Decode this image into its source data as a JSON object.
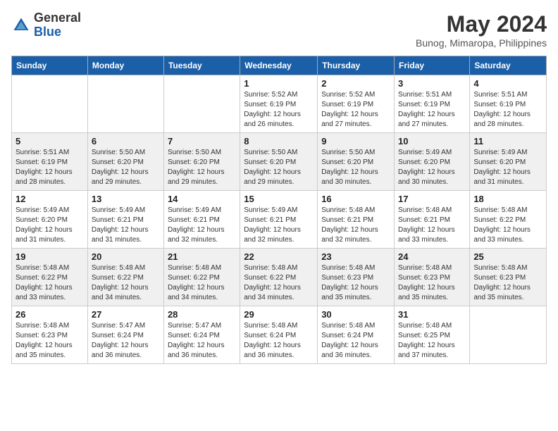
{
  "header": {
    "logo_line1": "General",
    "logo_line2": "Blue",
    "month_title": "May 2024",
    "location": "Bunog, Mimaropa, Philippines"
  },
  "days_of_week": [
    "Sunday",
    "Monday",
    "Tuesday",
    "Wednesday",
    "Thursday",
    "Friday",
    "Saturday"
  ],
  "weeks": [
    [
      {
        "day": "",
        "info": ""
      },
      {
        "day": "",
        "info": ""
      },
      {
        "day": "",
        "info": ""
      },
      {
        "day": "1",
        "info": "Sunrise: 5:52 AM\nSunset: 6:19 PM\nDaylight: 12 hours and 26 minutes."
      },
      {
        "day": "2",
        "info": "Sunrise: 5:52 AM\nSunset: 6:19 PM\nDaylight: 12 hours and 27 minutes."
      },
      {
        "day": "3",
        "info": "Sunrise: 5:51 AM\nSunset: 6:19 PM\nDaylight: 12 hours and 27 minutes."
      },
      {
        "day": "4",
        "info": "Sunrise: 5:51 AM\nSunset: 6:19 PM\nDaylight: 12 hours and 28 minutes."
      }
    ],
    [
      {
        "day": "5",
        "info": "Sunrise: 5:51 AM\nSunset: 6:19 PM\nDaylight: 12 hours and 28 minutes."
      },
      {
        "day": "6",
        "info": "Sunrise: 5:50 AM\nSunset: 6:20 PM\nDaylight: 12 hours and 29 minutes."
      },
      {
        "day": "7",
        "info": "Sunrise: 5:50 AM\nSunset: 6:20 PM\nDaylight: 12 hours and 29 minutes."
      },
      {
        "day": "8",
        "info": "Sunrise: 5:50 AM\nSunset: 6:20 PM\nDaylight: 12 hours and 29 minutes."
      },
      {
        "day": "9",
        "info": "Sunrise: 5:50 AM\nSunset: 6:20 PM\nDaylight: 12 hours and 30 minutes."
      },
      {
        "day": "10",
        "info": "Sunrise: 5:49 AM\nSunset: 6:20 PM\nDaylight: 12 hours and 30 minutes."
      },
      {
        "day": "11",
        "info": "Sunrise: 5:49 AM\nSunset: 6:20 PM\nDaylight: 12 hours and 31 minutes."
      }
    ],
    [
      {
        "day": "12",
        "info": "Sunrise: 5:49 AM\nSunset: 6:20 PM\nDaylight: 12 hours and 31 minutes."
      },
      {
        "day": "13",
        "info": "Sunrise: 5:49 AM\nSunset: 6:21 PM\nDaylight: 12 hours and 31 minutes."
      },
      {
        "day": "14",
        "info": "Sunrise: 5:49 AM\nSunset: 6:21 PM\nDaylight: 12 hours and 32 minutes."
      },
      {
        "day": "15",
        "info": "Sunrise: 5:49 AM\nSunset: 6:21 PM\nDaylight: 12 hours and 32 minutes."
      },
      {
        "day": "16",
        "info": "Sunrise: 5:48 AM\nSunset: 6:21 PM\nDaylight: 12 hours and 32 minutes."
      },
      {
        "day": "17",
        "info": "Sunrise: 5:48 AM\nSunset: 6:21 PM\nDaylight: 12 hours and 33 minutes."
      },
      {
        "day": "18",
        "info": "Sunrise: 5:48 AM\nSunset: 6:22 PM\nDaylight: 12 hours and 33 minutes."
      }
    ],
    [
      {
        "day": "19",
        "info": "Sunrise: 5:48 AM\nSunset: 6:22 PM\nDaylight: 12 hours and 33 minutes."
      },
      {
        "day": "20",
        "info": "Sunrise: 5:48 AM\nSunset: 6:22 PM\nDaylight: 12 hours and 34 minutes."
      },
      {
        "day": "21",
        "info": "Sunrise: 5:48 AM\nSunset: 6:22 PM\nDaylight: 12 hours and 34 minutes."
      },
      {
        "day": "22",
        "info": "Sunrise: 5:48 AM\nSunset: 6:22 PM\nDaylight: 12 hours and 34 minutes."
      },
      {
        "day": "23",
        "info": "Sunrise: 5:48 AM\nSunset: 6:23 PM\nDaylight: 12 hours and 35 minutes."
      },
      {
        "day": "24",
        "info": "Sunrise: 5:48 AM\nSunset: 6:23 PM\nDaylight: 12 hours and 35 minutes."
      },
      {
        "day": "25",
        "info": "Sunrise: 5:48 AM\nSunset: 6:23 PM\nDaylight: 12 hours and 35 minutes."
      }
    ],
    [
      {
        "day": "26",
        "info": "Sunrise: 5:48 AM\nSunset: 6:23 PM\nDaylight: 12 hours and 35 minutes."
      },
      {
        "day": "27",
        "info": "Sunrise: 5:47 AM\nSunset: 6:24 PM\nDaylight: 12 hours and 36 minutes."
      },
      {
        "day": "28",
        "info": "Sunrise: 5:47 AM\nSunset: 6:24 PM\nDaylight: 12 hours and 36 minutes."
      },
      {
        "day": "29",
        "info": "Sunrise: 5:48 AM\nSunset: 6:24 PM\nDaylight: 12 hours and 36 minutes."
      },
      {
        "day": "30",
        "info": "Sunrise: 5:48 AM\nSunset: 6:24 PM\nDaylight: 12 hours and 36 minutes."
      },
      {
        "day": "31",
        "info": "Sunrise: 5:48 AM\nSunset: 6:25 PM\nDaylight: 12 hours and 37 minutes."
      },
      {
        "day": "",
        "info": ""
      }
    ]
  ]
}
